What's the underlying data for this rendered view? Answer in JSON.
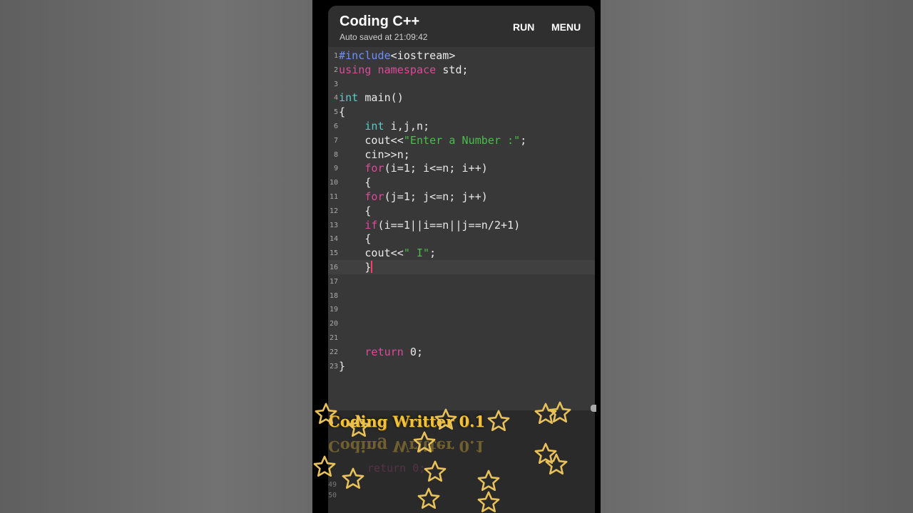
{
  "app": {
    "title": "Coding C++",
    "autosave": "Auto saved at 21:09:42",
    "run_label": "RUN",
    "menu_label": "MENU"
  },
  "editor": {
    "lines": [
      {
        "n": "1",
        "text": "#include<iostream>"
      },
      {
        "n": "2",
        "text": "using namespace std;"
      },
      {
        "n": "3",
        "text": ""
      },
      {
        "n": "4",
        "text": "int main()"
      },
      {
        "n": "5",
        "text": "{"
      },
      {
        "n": "6",
        "text": "    int i,j,n;"
      },
      {
        "n": "7",
        "text": "    cout<<\"Enter a Number :\";"
      },
      {
        "n": "8",
        "text": "    cin>>n;"
      },
      {
        "n": "9",
        "text": "    for(i=1; i<=n; i++)"
      },
      {
        "n": "10",
        "text": "    {"
      },
      {
        "n": "11",
        "text": "    for(j=1; j<=n; j++)"
      },
      {
        "n": "12",
        "text": "    {"
      },
      {
        "n": "13",
        "text": "    if(i==1||i==n||j==n/2+1)"
      },
      {
        "n": "14",
        "text": "    {"
      },
      {
        "n": "15",
        "text": "    cout<<\" I\";"
      },
      {
        "n": "16",
        "text": "    }"
      },
      {
        "n": "17",
        "text": ""
      },
      {
        "n": "18",
        "text": ""
      },
      {
        "n": "19",
        "text": ""
      },
      {
        "n": "20",
        "text": ""
      },
      {
        "n": "21",
        "text": ""
      },
      {
        "n": "22",
        "text": "    return 0;"
      },
      {
        "n": "23",
        "text": "}"
      }
    ],
    "current_line": 16
  },
  "overlay": {
    "brand": "Coding Writter 0.1",
    "ghost_code": "return 0;",
    "ghost_line_a": "49",
    "ghost_line_b": "50"
  },
  "colors": {
    "keyword_blue": "#6f8fff",
    "keyword_pink": "#e0489b",
    "type_teal": "#5ec9c9",
    "string_green": "#4bbd4b",
    "brand_gold": "#f2c13a"
  }
}
